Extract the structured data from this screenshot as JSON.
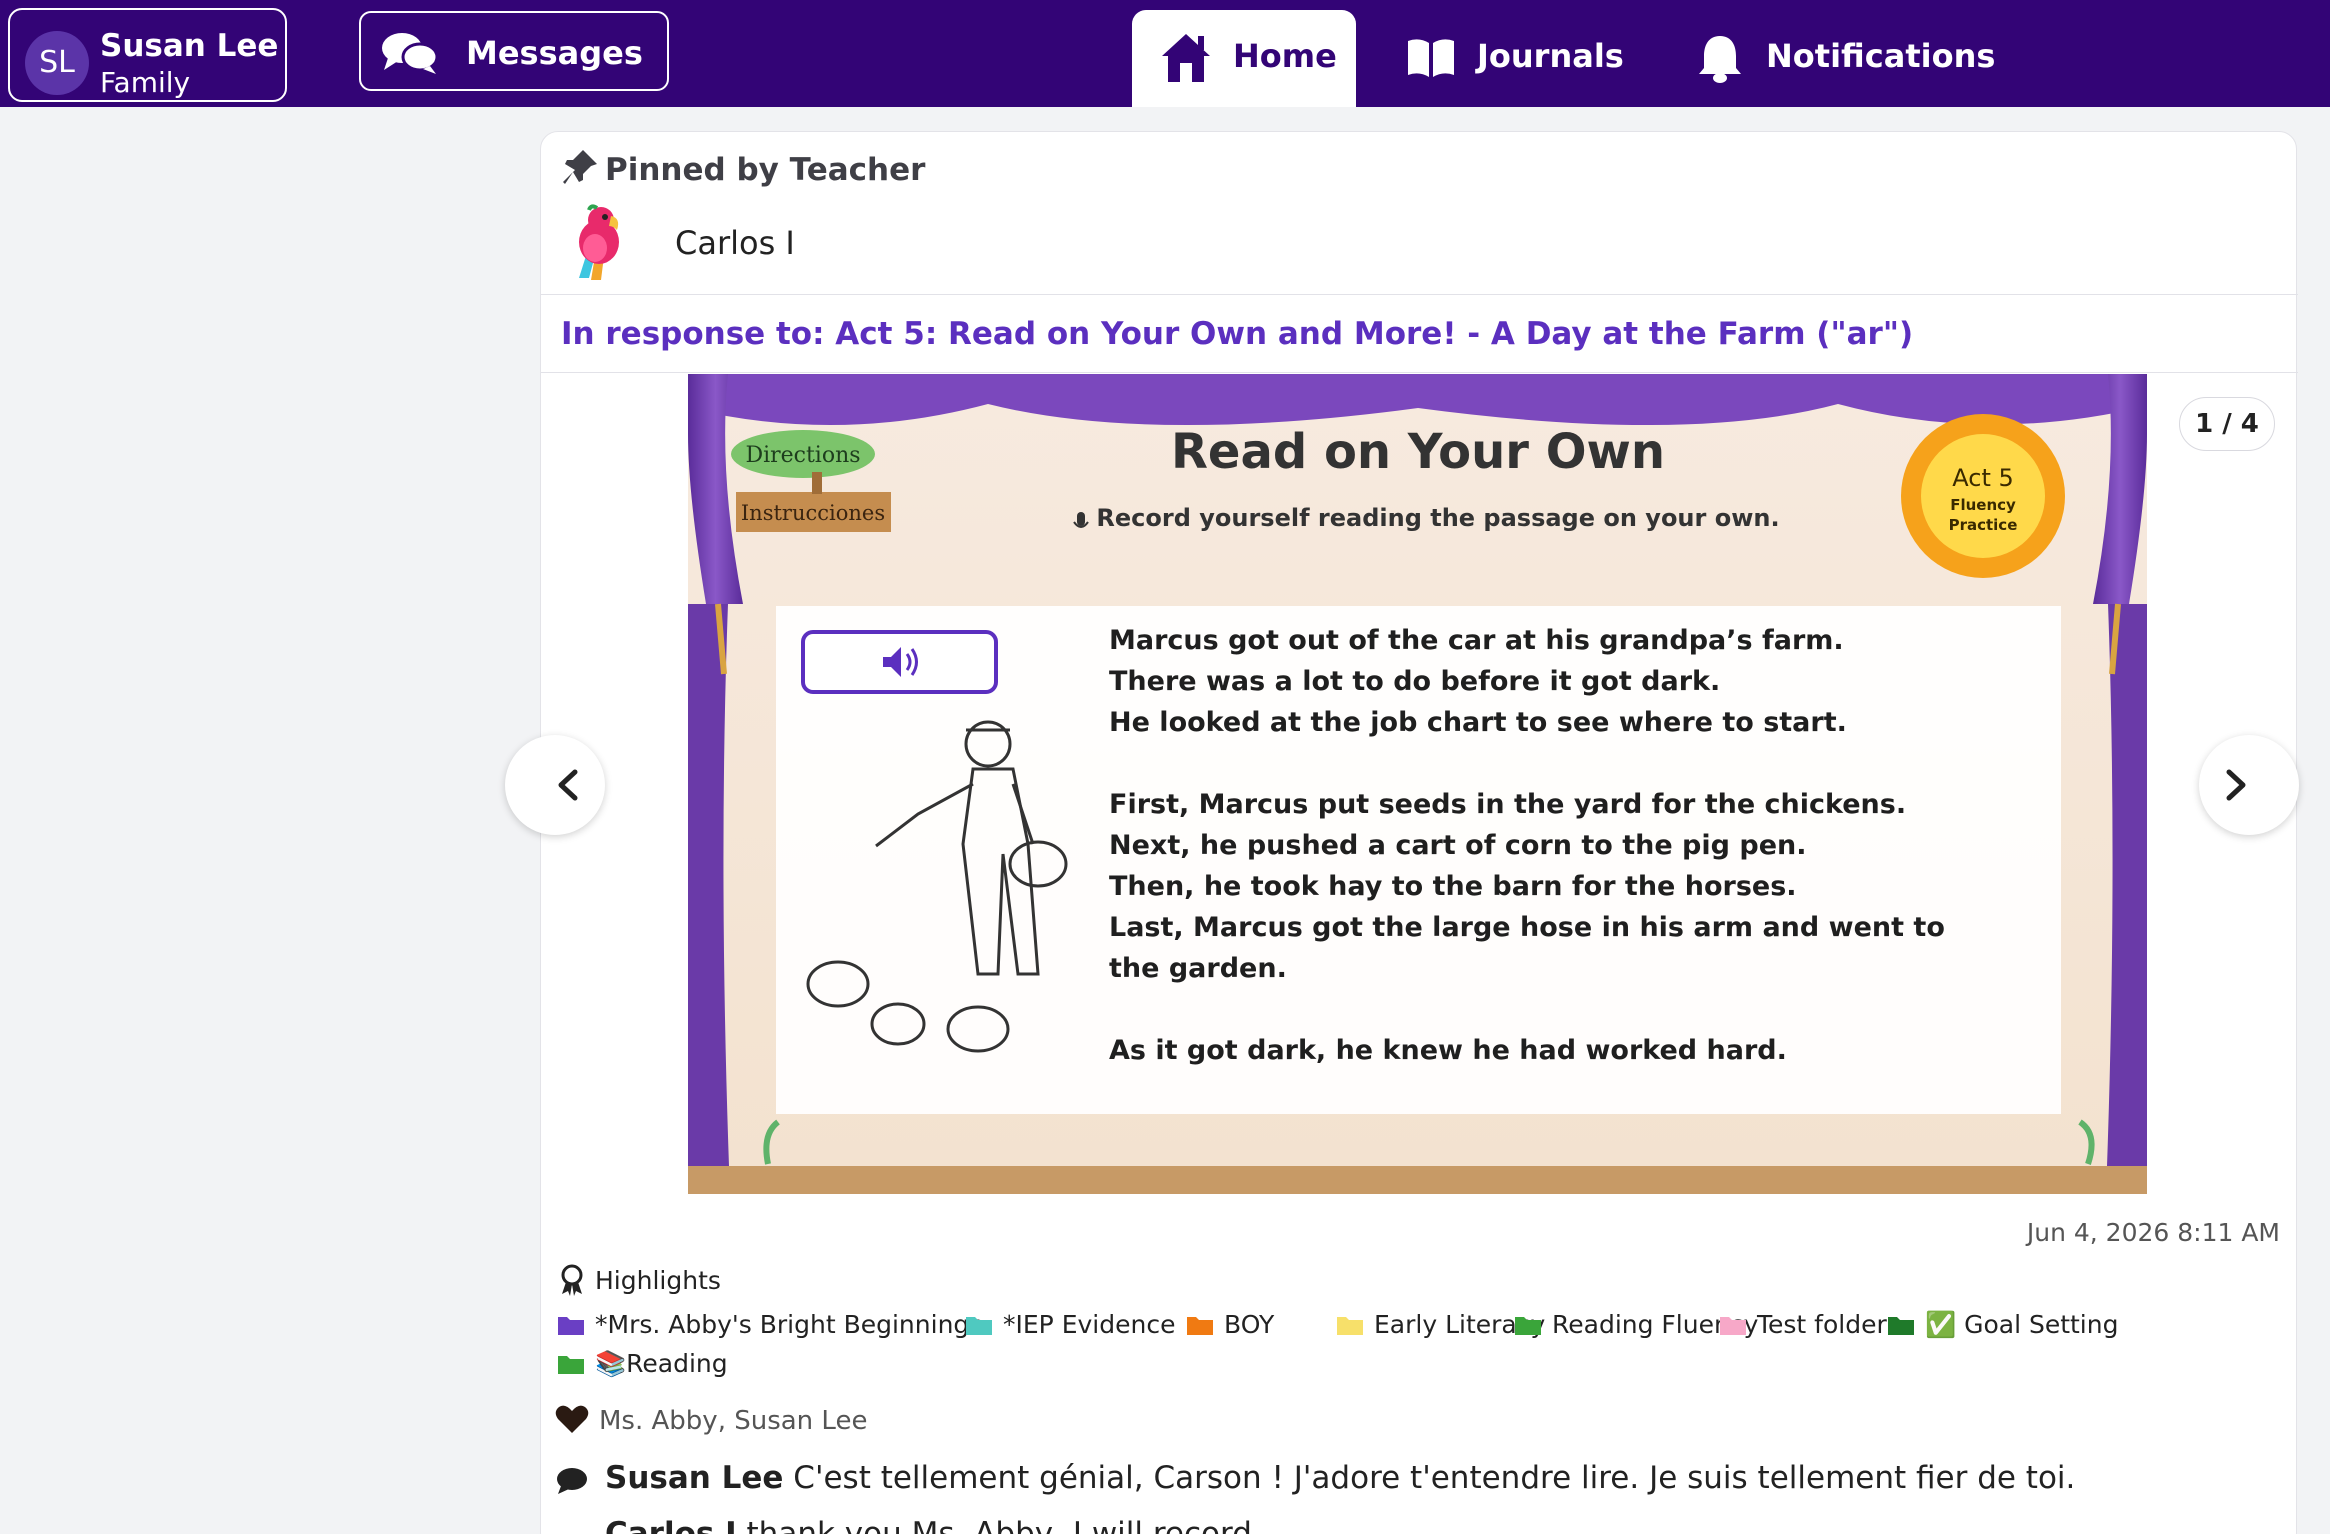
{
  "user": {
    "initials": "SL",
    "name": "Susan Lee",
    "role": "Family"
  },
  "messages": {
    "label": "Messages"
  },
  "nav": {
    "home": "Home",
    "journals": "Journals",
    "notifications": "Notifications"
  },
  "post": {
    "pinned_label": "Pinned by Teacher",
    "author": "Carlos I",
    "response_to": "In response to: Act 5: Read on Your Own and More! - A Day at the Farm (\"ar\")",
    "counter": "1 / 4",
    "timestamp": "Jun 4, 2026 8:11 AM",
    "slide": {
      "directions": "Directions",
      "instrucciones": "Instrucciones",
      "title": "Read on Your Own",
      "subtitle": "Record yourself reading the passage on your own.",
      "badge_act": "Act 5",
      "badge_line1": "Fluency",
      "badge_line2": "Practice",
      "passage": [
        "Marcus got out of the car at his grandpa’s farm.",
        "There was a lot to do before it got dark.",
        "He looked at the job chart to see where to start.",
        "",
        "First, Marcus put seeds in the yard for the chickens.",
        "Next, he pushed a cart of corn to the pig pen.",
        "Then, he took hay to the barn for the horses.",
        "Last, Marcus got the large hose in his arm and went to",
        "the garden.",
        "",
        "As it got dark, he knew he had worked hard."
      ]
    },
    "highlights_label": "Highlights",
    "folders": [
      {
        "label": "*Mrs. Abby's Bright Beginnings",
        "color": "#6a3fc4"
      },
      {
        "label": "*IEP Evidence",
        "color": "#4fc9c0"
      },
      {
        "label": "BOY",
        "color": "#f07a12"
      },
      {
        "label": "Early Literacy",
        "color": "#f7e06a"
      },
      {
        "label": "Reading Fluency",
        "color": "#3aa53a"
      },
      {
        "label": "Test folder",
        "color": "#f7a8c8"
      },
      {
        "label": "✅ Goal Setting",
        "color": "#1f7a2a"
      },
      {
        "label": "📚Reading",
        "color": "#3aa53a"
      }
    ],
    "likes": "Ms. Abby, Susan Lee",
    "comments": [
      {
        "author": "Susan Lee",
        "text": "C'est tellement génial, Carson ! J'adore t'entendre lire. Je suis tellement fier de toi."
      },
      {
        "author": "Carlos I",
        "text": "thank you Ms. Abby, I will record"
      }
    ]
  },
  "colors": {
    "brand": "#330476",
    "link": "#5b2fbf",
    "slide_curtain": "#6a3aa8"
  }
}
